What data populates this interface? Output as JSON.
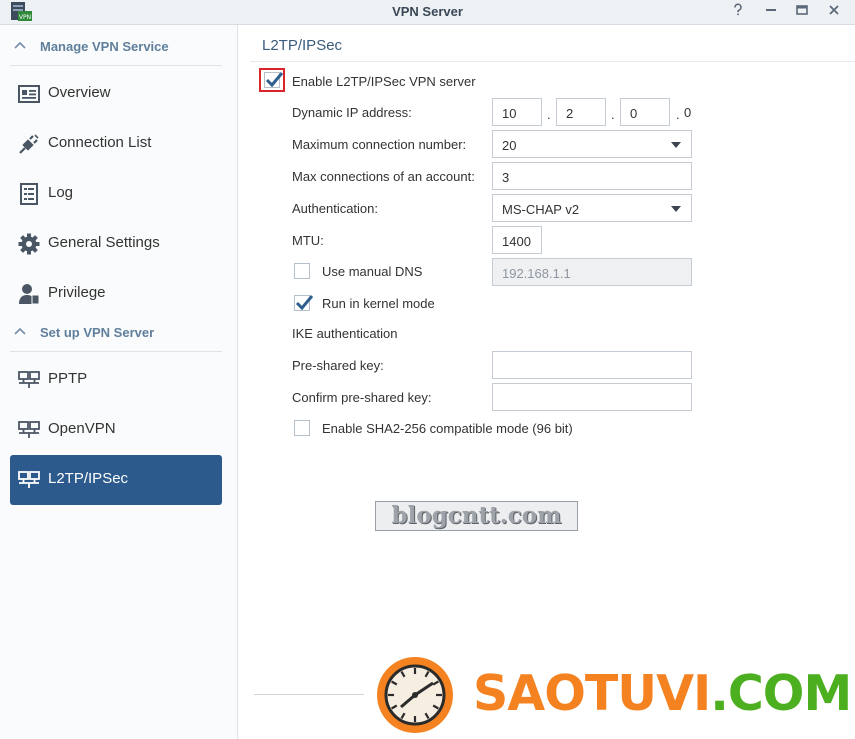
{
  "window": {
    "title": "VPN Server",
    "app_icon_text": "VPN",
    "buttons": [
      "help",
      "minimize",
      "maximize",
      "close"
    ]
  },
  "sidebar": {
    "section_manage": "Manage VPN Service",
    "manage_items": [
      {
        "label": "Overview",
        "icon": "overview-icon"
      },
      {
        "label": "Connection List",
        "icon": "plug-icon"
      },
      {
        "label": "Log",
        "icon": "log-icon"
      },
      {
        "label": "General Settings",
        "icon": "gear-icon"
      },
      {
        "label": "Privilege",
        "icon": "user-icon"
      }
    ],
    "section_setup": "Set up VPN Server",
    "setup_items": [
      {
        "label": "PPTP",
        "icon": "network-icon"
      },
      {
        "label": "OpenVPN",
        "icon": "network-icon"
      },
      {
        "label": "L2TP/IPSec",
        "icon": "network-icon",
        "active": true
      }
    ]
  },
  "main": {
    "title": "L2TP/IPSec",
    "enable_label": "Enable L2TP/IPSec VPN server",
    "enable_checked": true,
    "dynamic_ip_label": "Dynamic IP address:",
    "ip_octets": [
      "10",
      "2",
      "0",
      "0"
    ],
    "ip_dot": ".",
    "max_conn_label": "Maximum connection number:",
    "max_conn_value": "20",
    "max_acct_label": "Max connections of an account:",
    "max_acct_value": "3",
    "auth_label": "Authentication:",
    "auth_value": "MS-CHAP v2",
    "mtu_label": "MTU:",
    "mtu_value": "1400",
    "manual_dns_label": "Use manual DNS",
    "manual_dns_checked": false,
    "dns_placeholder": "192.168.1.1",
    "kernel_label": "Run in kernel mode",
    "kernel_checked": true,
    "ike_label": "IKE authentication",
    "psk_label": "Pre-shared key:",
    "psk_value": "",
    "confirm_psk_label": "Confirm pre-shared key:",
    "confirm_psk_value": "",
    "sha2_label": "Enable SHA2-256 compatible mode (96 bit)",
    "sha2_checked": false
  },
  "watermarks": {
    "blog": "blogcntt.com",
    "sao_part1": "SAOTUVI",
    "sao_part2": ".COM"
  },
  "colors": {
    "accent_blue": "#2c5a8c",
    "section_text": "#5f7f9c",
    "check_blue": "#2f5f8e",
    "highlight_red": "#d9252a",
    "wm_orange": "#f58220",
    "wm_green": "#4caf1f"
  }
}
